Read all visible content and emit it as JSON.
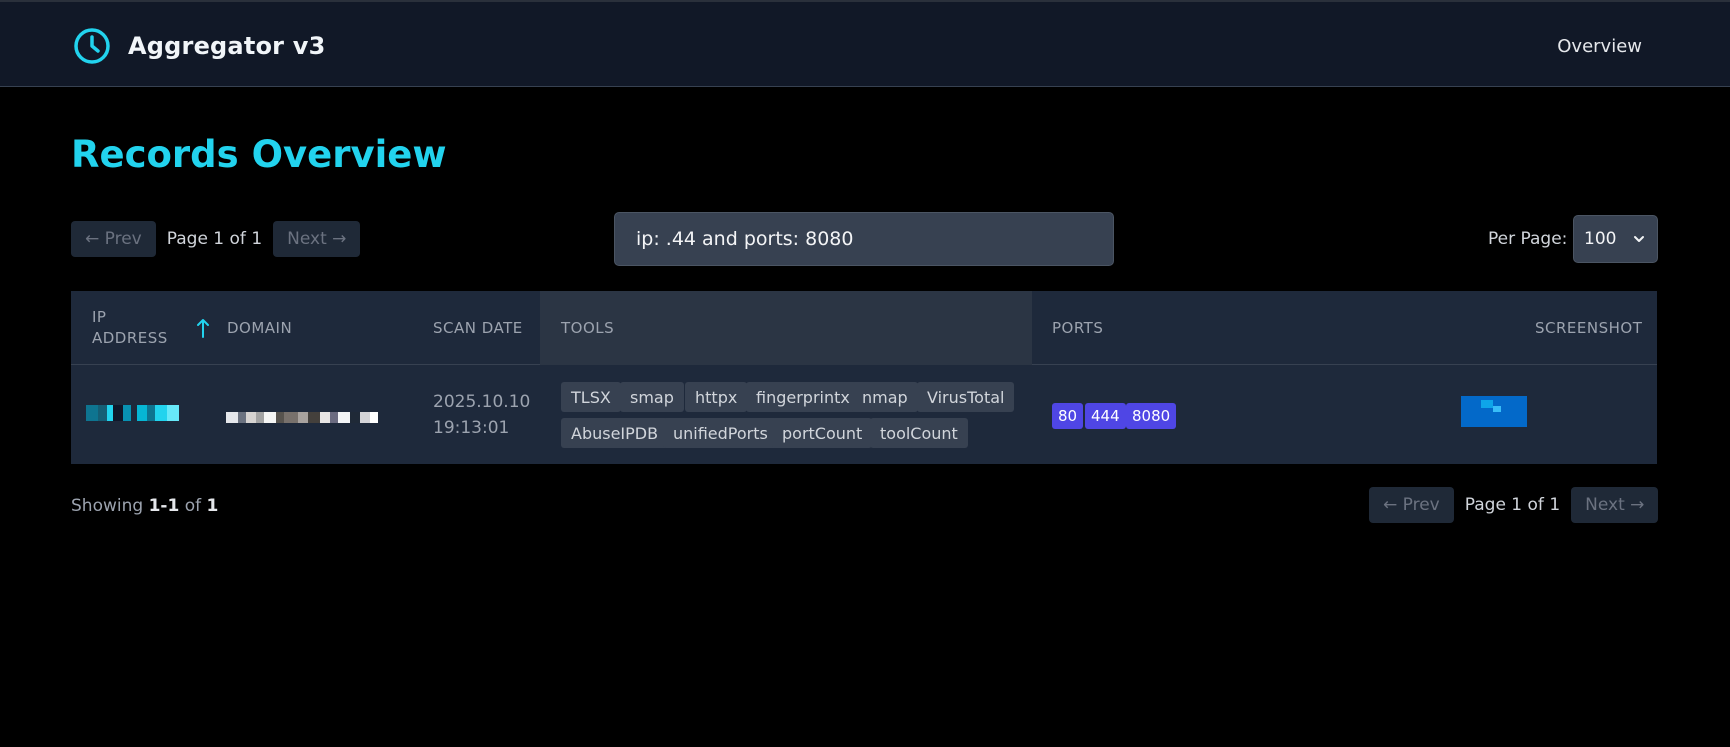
{
  "app": {
    "title": "Aggregator v3"
  },
  "nav": {
    "overview": "Overview"
  },
  "page": {
    "title": "Records Overview"
  },
  "pagination": {
    "prev": "← Prev",
    "next": "→",
    "next_label": "Next →",
    "page_info": "Page 1 of 1"
  },
  "search": {
    "value": "ip: .44 and ports: 8080",
    "placeholder": ""
  },
  "per_page": {
    "label": "Per Page:",
    "value": "100"
  },
  "table": {
    "headers": {
      "ip_line1": "IP",
      "ip_line2": "ADDRESS",
      "domain": "DOMAIN",
      "scan_date": "SCAN DATE",
      "tools": "TOOLS",
      "ports": "PORTS",
      "screenshot": "SCREENSHOT"
    },
    "rows": [
      {
        "scan_date_line1": "2025.10.10",
        "scan_date_line2": "19:13:01",
        "tools": [
          "TLSX",
          "smap",
          "httpx",
          "fingerprintx",
          "nmap",
          "VirusTotal",
          "AbuseIPDB",
          "unifiedPorts",
          "portCount",
          "toolCount"
        ],
        "ports": [
          "80",
          "444",
          "8080"
        ]
      }
    ]
  },
  "footer": {
    "showing_word": "Showing",
    "range_start": "1",
    "dash": "-",
    "range_end": "1",
    "of_word": "of",
    "total": "1"
  },
  "colors": {
    "accent": "#22d3ee",
    "port_badge": "#4f46e5",
    "header_bg": "#111827"
  },
  "icons": {
    "brand": "clock-icon",
    "sort": "arrow-up-icon",
    "select": "chevron-down-icon"
  }
}
